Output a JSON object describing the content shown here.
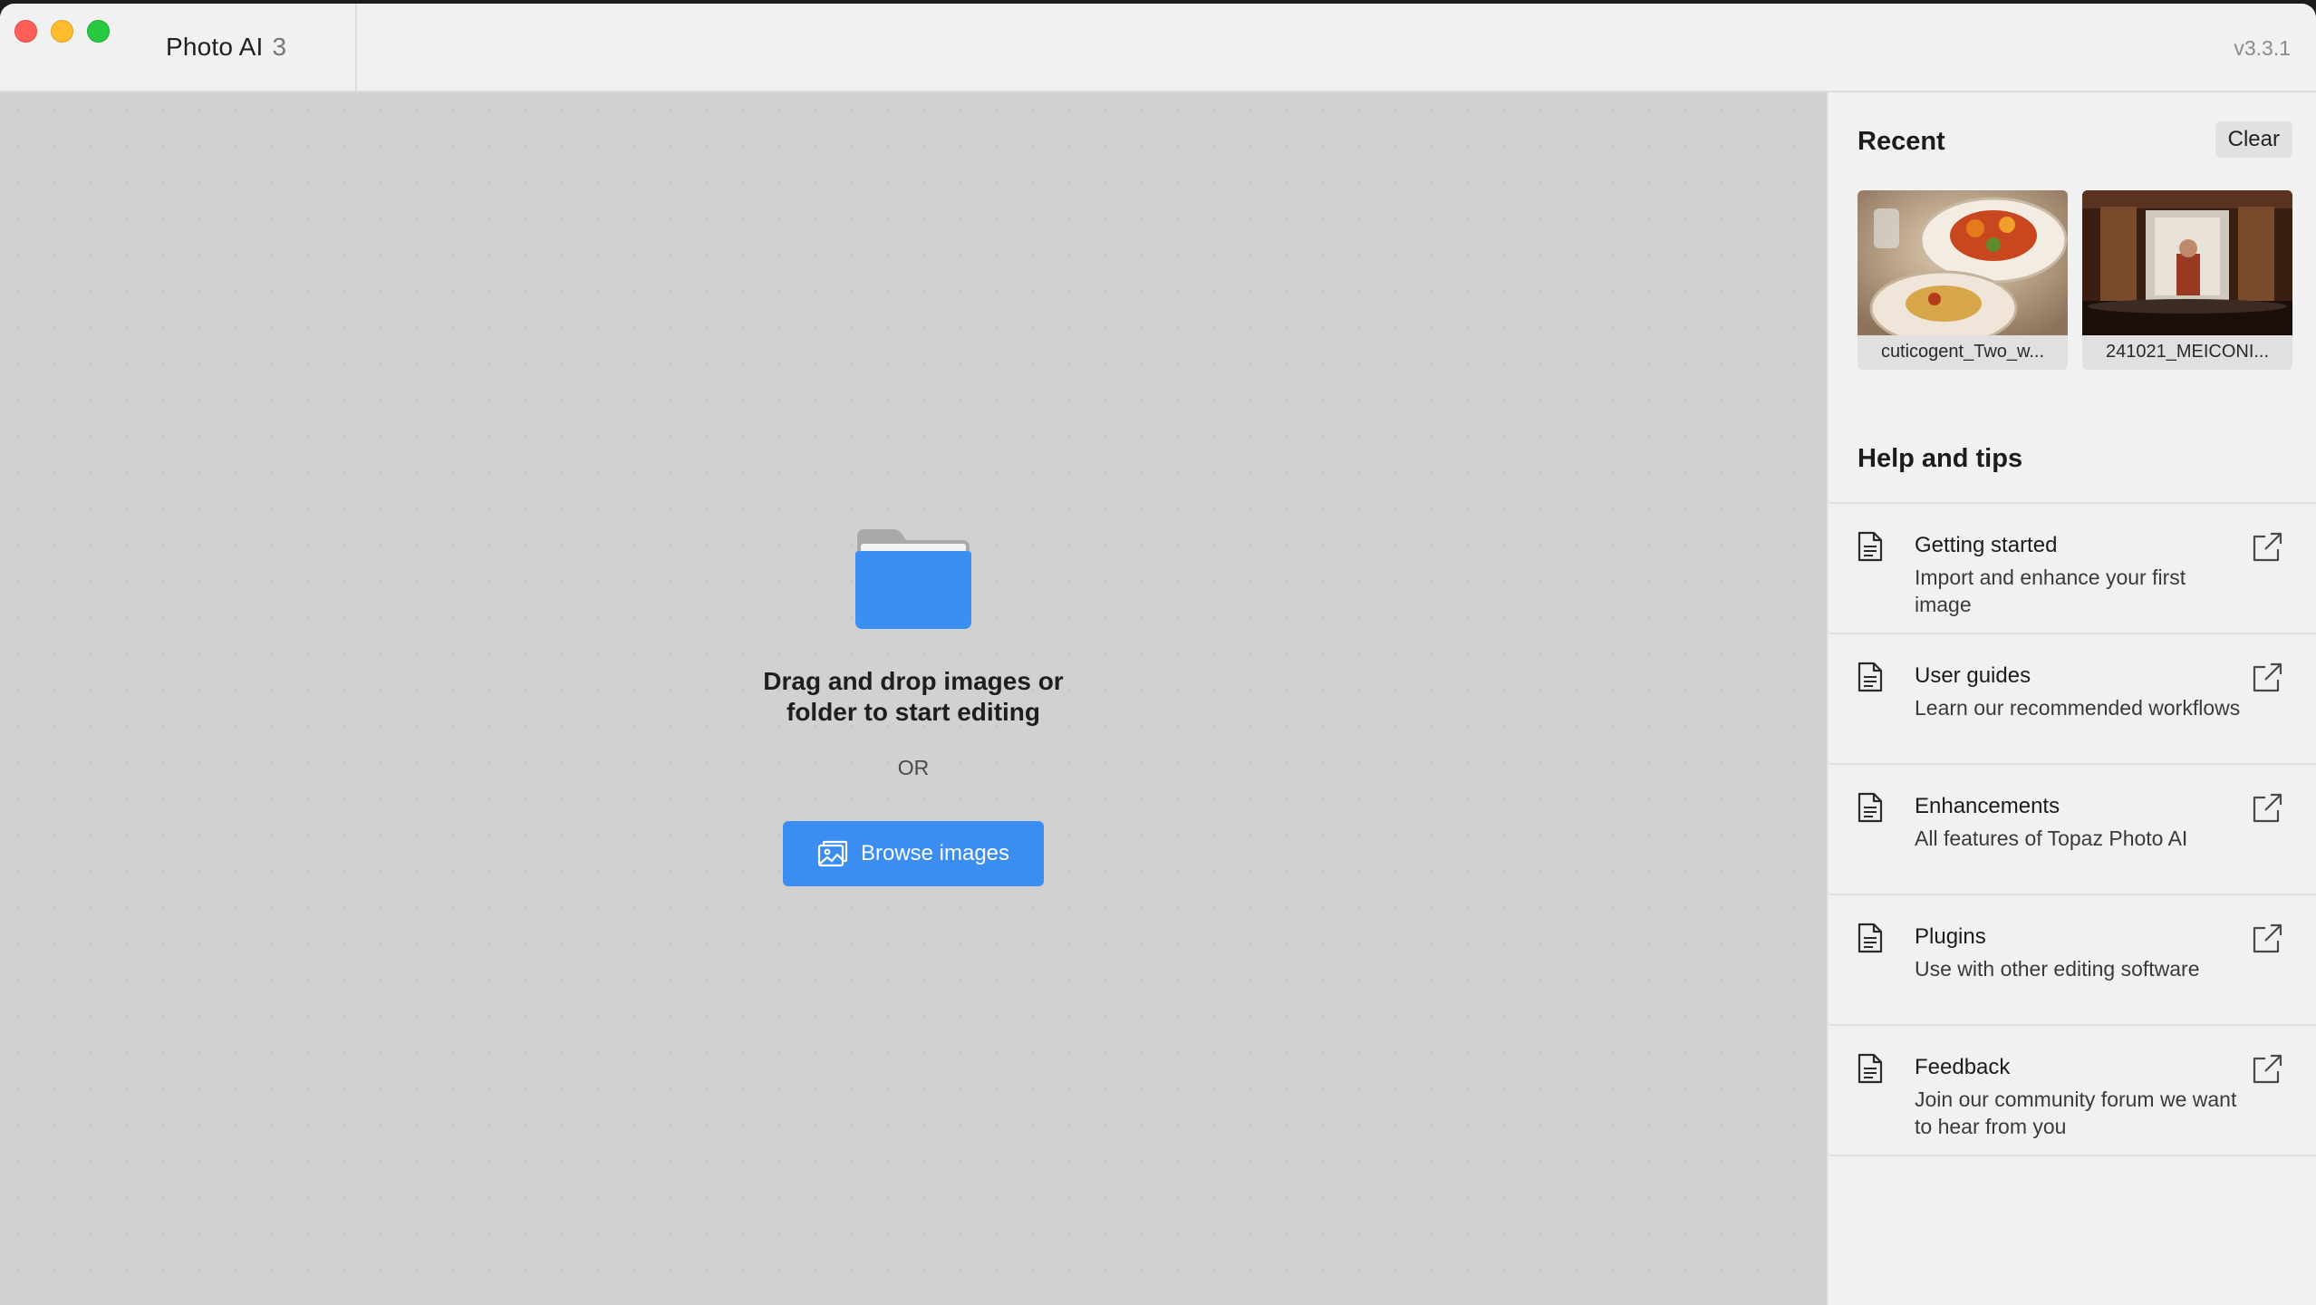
{
  "window": {
    "app_name": "Photo AI",
    "app_version_major": "3",
    "version": "v3.3.1"
  },
  "dropzone": {
    "instruction_line1": "Drag and drop images or",
    "instruction_line2": "folder to start editing",
    "or_text": "OR",
    "browse_label": "Browse images",
    "folder_icon": "folder-icon",
    "accent_color": "#3b8df2"
  },
  "recent": {
    "title": "Recent",
    "clear_label": "Clear",
    "items": [
      {
        "name": "cuticogent_Two_w..."
      },
      {
        "name": "241021_MEICONI..."
      }
    ]
  },
  "help": {
    "title": "Help and tips",
    "items": [
      {
        "title": "Getting started",
        "desc": "Import and enhance your first image"
      },
      {
        "title": "User guides",
        "desc": "Learn our recommended workflows"
      },
      {
        "title": "Enhancements",
        "desc": "All features of Topaz Photo AI"
      },
      {
        "title": "Plugins",
        "desc": "Use with other editing software"
      },
      {
        "title": "Feedback",
        "desc": "Join our community forum we want to hear from you"
      }
    ]
  }
}
